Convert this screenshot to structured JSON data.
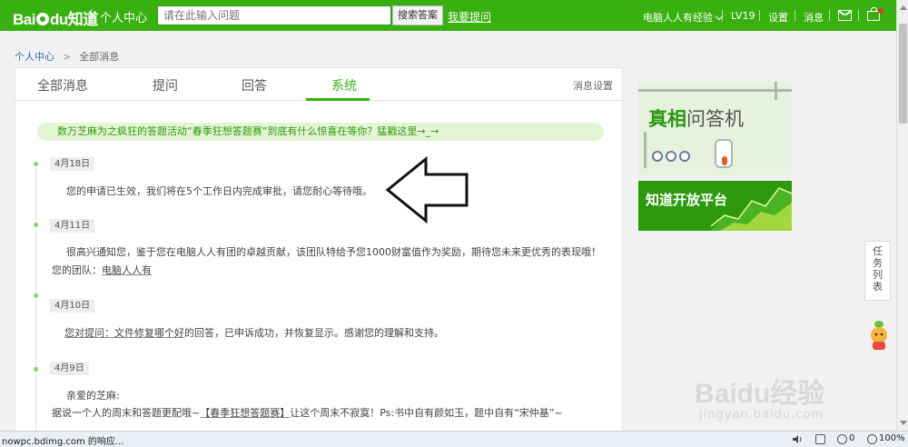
{
  "header": {
    "logo_text": "Bai",
    "logo_text2": "du",
    "logo_cn": "知道",
    "center_title": "个人中心",
    "search_placeholder": "请在此输入问题",
    "search_button": "搜索答案",
    "ask_link": "我要提问",
    "user_name": "电脑人人有经验",
    "level": "LV19",
    "settings": "设置",
    "messages": "消息",
    "colors": {
      "brand": "#38b110"
    }
  },
  "breadcrumb": {
    "home": "个人中心",
    "sep": ">",
    "current": "全部消息"
  },
  "tabs": [
    {
      "label": "全部消息"
    },
    {
      "label": "提问"
    },
    {
      "label": "回答"
    },
    {
      "label": "系统"
    }
  ],
  "active_tab": "系统",
  "message_settings": "消息设置",
  "promo": "数万芝麻为之疯狂的答题活动“春季狂想答题赛”到底有什么惊喜在等你？猛戳这里→_→",
  "messages": [
    {
      "date": "4月18日",
      "text": "您的申请已生效，我们将在5个工作日内完成审批，请您耐心等待哦。"
    },
    {
      "date": "4月11日",
      "text": "很高兴通知您，鉴于您在电脑人人有团的卓越贡献，该团队特给予您1000财富值作为奖励，期待您未来更优秀的表现哦！",
      "team_prefix": "您的团队：",
      "team_link": "电脑人人有"
    },
    {
      "date": "4月10日",
      "link": "您对提问：文件修复哪个好",
      "text": "的回答，已申诉成功，并恢复显示。感谢您的理解和支持。"
    },
    {
      "date": "4月9日",
      "greeting": "亲爱的芝麻:",
      "line_prefix": "据说一个人的周末和答题更配哦~",
      "link": "【春季狂想答题赛】",
      "line_suffix": "让这个周末不寂寞！Ps:书中自有颜如玉，题中自有“宋仲基”~"
    }
  ],
  "sidebar": {
    "ad1_part1": "真相",
    "ad1_part2": "问答机",
    "ad2_title": "知道开放平台",
    "task_list": [
      "任",
      "务",
      "列",
      "表"
    ]
  },
  "watermark": {
    "main": "Baidu经验",
    "sub": "jingyan.baidu.com"
  },
  "statusbar": {
    "text": "nowpc.bdimg.com 的响应...",
    "count": "0",
    "zoom": "100%"
  }
}
